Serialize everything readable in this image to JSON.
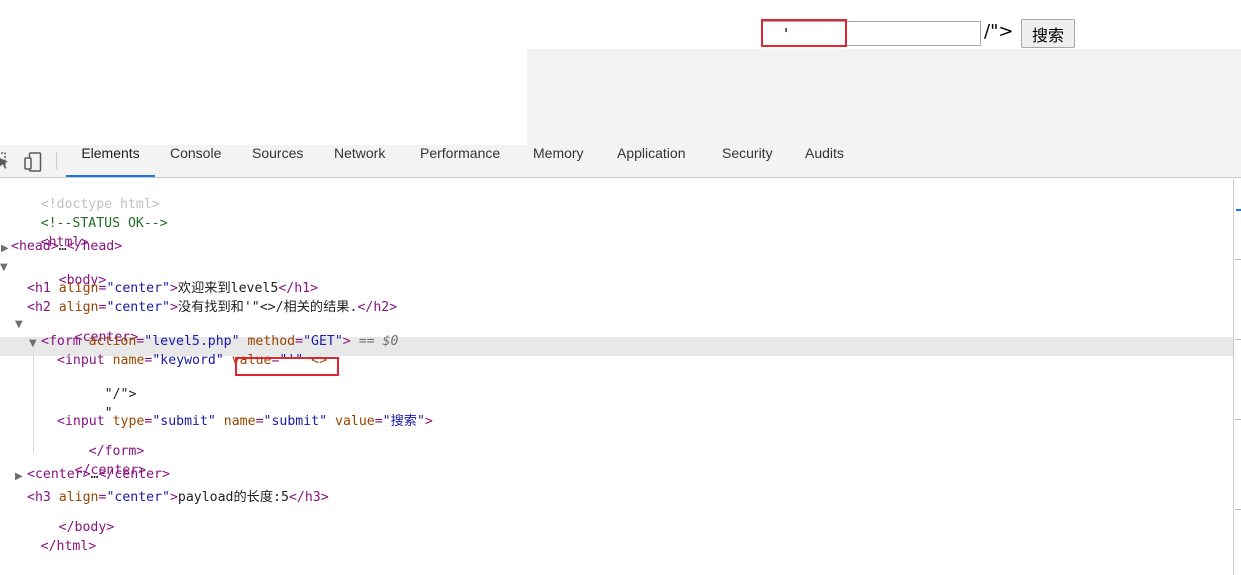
{
  "page": {
    "keyword_value": "'",
    "stray_text": "/\">",
    "submit_label": "搜索"
  },
  "devtools": {
    "tabs": [
      "Elements",
      "Console",
      "Sources",
      "Network",
      "Performance",
      "Memory",
      "Application",
      "Security",
      "Audits"
    ],
    "active_tab": "Elements"
  },
  "dom": {
    "doctype": "<!doctype html>",
    "comment": "<!--STATUS OK-->",
    "html_open": "<html>",
    "head_open": "<head>",
    "head_ellipsis": "…",
    "head_close": "</head>",
    "body_open": "<body>",
    "h1_open": "<h1",
    "h1_attr": "align",
    "h1_val": "\"center\"",
    "h1_gt": ">",
    "h1_text": "欢迎来到level5",
    "h1_close": "</h1>",
    "h2_open": "<h2",
    "h2_attr": "align",
    "h2_val": "\"center\"",
    "h2_gt": ">",
    "h2_text": "没有找到和'\"<>/相关的结果.",
    "h2_close": "</h2>",
    "center_open": "<center>",
    "form_open": "<form",
    "form_attr1": "action",
    "form_val1": "\"level5.php\"",
    "form_attr2": "method",
    "form_val2": "\"GET\"",
    "form_gt": ">",
    "sel_ref": "== $0",
    "input1_open": "<input",
    "input1_attr1": "name",
    "input1_val1": "\"keyword\"",
    "input1_attr2": "value",
    "input1_val2": "\"'\"",
    "input1_rest": "<>",
    "text_node1": "\"/\">",
    "text_node2": "\"",
    "input2_open": "<input",
    "input2_attr1": "type",
    "input2_val1": "\"submit\"",
    "input2_attr2": "name",
    "input2_val2": "\"submit\"",
    "input2_attr3": "value",
    "input2_val3": "\"搜索\"",
    "input2_gt": ">",
    "form_close": "</form>",
    "center_close": "</center>",
    "center2_open": "<center>",
    "center2_ellipsis": "…",
    "center2_close": "</center>",
    "h3_open": "<h3",
    "h3_attr": "align",
    "h3_val": "\"center\"",
    "h3_gt": ">",
    "h3_text": "payload的长度:5",
    "h3_close": "</h3>",
    "body_close": "</body>",
    "html_close": "</html>"
  },
  "colors": {
    "highlight_box": "#e2262f",
    "tag": "#881280",
    "attr_name": "#994500",
    "attr_value": "#1a1aa6",
    "comment": "#236e25",
    "active_tab_underline": "#1a73e8"
  },
  "icons": [
    "inspect-icon",
    "device-toggle-icon",
    "expand-triangle-icon",
    "collapse-triangle-icon"
  ]
}
